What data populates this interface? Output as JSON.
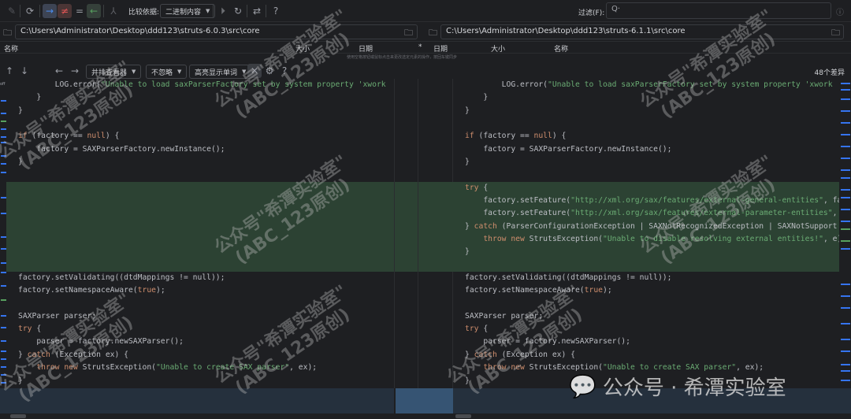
{
  "toolbar": {
    "compare_by_label": "比较依据:",
    "compare_by_value": "二进制内容",
    "filter_label": "过滤(F):",
    "filter_placeholder": "Q·",
    "help": "?"
  },
  "left": {
    "path": "C:\\Users\\Administrator\\Desktop\\ddd123\\struts-6.0.3\\src\\core"
  },
  "right": {
    "path": "C:\\Users\\Administrator\\Desktop\\ddd123\\struts-6.1.1\\src\\core"
  },
  "columns": {
    "name": "名称",
    "size": "大小",
    "date": "日期",
    "star": "*",
    "date2": "日期",
    "size2": "大小",
    "name2": "名称"
  },
  "hint": "使用空格按钮或鼠标点击来更改选定元素的操作，按回车键同步",
  "diff_toolbar": {
    "viewer": "并排查看器",
    "ignore": "不忽略",
    "highlight": "高亮显示单词",
    "help": "?",
    "diff_count": "48个差异",
    "gutter_label": "off"
  },
  "code": {
    "left": {
      "top": [
        [
          [
            "p",
            "        "
          ],
          [
            "p",
            "LOG.error("
          ],
          [
            "s",
            "\"Unable to load saxParserFactory set by system property 'xwork"
          ]
        ],
        [
          [
            "p",
            "    }"
          ]
        ],
        [
          [
            "p",
            "}"
          ]
        ],
        [],
        [
          [
            "k",
            "if"
          ],
          [
            "p",
            " (factory == "
          ],
          [
            "k",
            "null"
          ],
          [
            "p",
            ") {"
          ]
        ],
        [
          [
            "p",
            "    factory = SAXParserFactory.newInstance();"
          ]
        ],
        [
          [
            "p",
            "}"
          ]
        ],
        []
      ],
      "green": [],
      "bottom": [
        [
          [
            "p",
            "factory.setValidating((dtdMappings != null));"
          ]
        ],
        [
          [
            "p",
            "factory.setNamespaceAware("
          ],
          [
            "k",
            "true"
          ],
          [
            "p",
            ");"
          ]
        ],
        [],
        [
          [
            "p",
            "SAXParser parser;"
          ]
        ],
        [
          [
            "k",
            "try"
          ],
          [
            "p",
            " {"
          ]
        ],
        [
          [
            "p",
            "    parser = factory.newSAXParser();"
          ]
        ],
        [
          [
            "p",
            "} "
          ],
          [
            "k",
            "catch"
          ],
          [
            "p",
            " (Exception ex) {"
          ]
        ],
        [
          [
            "p",
            "    "
          ],
          [
            "k",
            "throw new"
          ],
          [
            "p",
            " StrutsException("
          ],
          [
            "s",
            "\"Unable to create SAX parser\""
          ],
          [
            "p",
            ", ex);"
          ]
        ],
        [
          [
            "p",
            "}"
          ]
        ]
      ]
    },
    "right": {
      "top": [
        [
          [
            "p",
            "        LOG.error("
          ],
          [
            "s",
            "\"Unable to load saxParserFactory set by system property 'xwork"
          ]
        ],
        [
          [
            "p",
            "    }"
          ]
        ],
        [
          [
            "p",
            "}"
          ]
        ],
        [],
        [
          [
            "k",
            "if"
          ],
          [
            "p",
            " (factory == "
          ],
          [
            "k",
            "null"
          ],
          [
            "p",
            ") {"
          ]
        ],
        [
          [
            "p",
            "    factory = SAXParserFactory.newInstance();"
          ]
        ],
        [
          [
            "p",
            "}"
          ]
        ],
        []
      ],
      "green": [
        [
          [
            "k",
            "try"
          ],
          [
            "p",
            " {"
          ]
        ],
        [
          [
            "p",
            "    factory.setFeature("
          ],
          [
            "s",
            "\"http://xml.org/sax/features/external-general-entities\""
          ],
          [
            "p",
            ", fa"
          ]
        ],
        [
          [
            "p",
            "    factory.setFeature("
          ],
          [
            "s",
            "\"http://xml.org/sax/features/external-parameter-entities\""
          ],
          [
            "p",
            ","
          ]
        ],
        [
          [
            "p",
            "} "
          ],
          [
            "k",
            "catch"
          ],
          [
            "p",
            " (ParserConfigurationException | SAXNotRecognizedException | SAXNotSupport"
          ]
        ],
        [
          [
            "p",
            "    "
          ],
          [
            "k",
            "throw new"
          ],
          [
            "p",
            " StrutsException("
          ],
          [
            "s",
            "\"Unable to disable resolving external entities!\""
          ],
          [
            "p",
            ", e)"
          ]
        ],
        [
          [
            "p",
            "}"
          ]
        ]
      ],
      "bottom": [
        [
          [
            "p",
            "factory.setValidating((dtdMappings != null));"
          ]
        ],
        [
          [
            "p",
            "factory.setNamespaceAware("
          ],
          [
            "k",
            "true"
          ],
          [
            "p",
            ");"
          ]
        ],
        [],
        [
          [
            "p",
            "SAXParser parser;"
          ]
        ],
        [
          [
            "k",
            "try"
          ],
          [
            "p",
            " {"
          ]
        ],
        [
          [
            "p",
            "    parser = factory.newSAXParser();"
          ]
        ],
        [
          [
            "p",
            "} "
          ],
          [
            "k",
            "catch"
          ],
          [
            "p",
            " (Exception ex) {"
          ]
        ],
        [
          [
            "p",
            "    "
          ],
          [
            "k",
            "throw new"
          ],
          [
            "p",
            " StrutsException("
          ],
          [
            "s",
            "\"Unable to create SAX parser\""
          ],
          [
            "p",
            ", ex);"
          ]
        ],
        [
          [
            "p",
            "}"
          ]
        ]
      ]
    }
  },
  "watermark": {
    "line1": "公众号\"希潭实验室\"",
    "line2": "(ABC_123原创)",
    "logo": "公众号 · 希潭实验室"
  },
  "colors": {
    "added": "#2c4233",
    "keyword": "#cf8e6d",
    "string": "#6aab73",
    "selection": "#263444"
  }
}
